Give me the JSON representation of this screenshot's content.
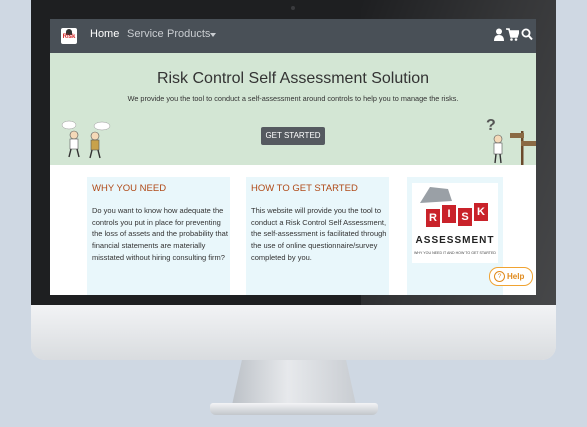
{
  "navbar": {
    "logo_text": "Risk",
    "items": [
      {
        "label": "Home"
      },
      {
        "label": "Service"
      },
      {
        "label": "Products"
      }
    ],
    "icons": [
      "user-icon",
      "cart-icon",
      "search-icon"
    ]
  },
  "hero": {
    "title": "Risk Control Self Assessment Solution",
    "subtitle": "We provide you the tool to conduct a self-assessment around controls to help you to manage the risks.",
    "button_label": "GET STARTED",
    "question_mark": "?",
    "bg_color": "#d3e6d4"
  },
  "cards": [
    {
      "title": "WHY YOU NEED",
      "body": "Do you want to know how adequate the controls you put in place for preventing the loss of assets and the probability that financial statements are materially misstated without hiring consulting firm?"
    },
    {
      "title": "HOW TO GET STARTED",
      "body": "This website will provide you the tool to conduct a Risk Control Self Assessment, the self-assessment is facilitated through the use of online questionnaire/survey completed by you."
    }
  ],
  "risk_image": {
    "letters": [
      "R",
      "I",
      "S",
      "K"
    ],
    "word": "ASSESSMENT",
    "caption": "WHY YOU NEED IT AND HOW TO GET STARTED"
  },
  "help": {
    "icon": "?",
    "label": "Help"
  },
  "colors": {
    "navbar": "#495057",
    "card_title": "#b04a18",
    "card_bg": "#e9f7fb",
    "help_accent": "#e08a1d"
  }
}
